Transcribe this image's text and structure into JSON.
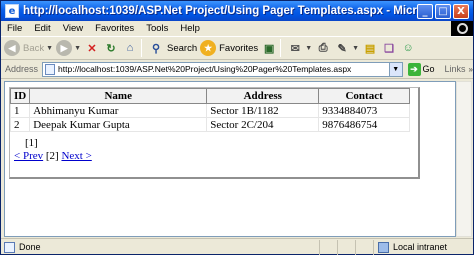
{
  "window": {
    "title": "http://localhost:1039/ASP.Net Project/Using Pager Templates.aspx - Microsoft Internet Explorer",
    "minimize": "_",
    "maximize": "□",
    "close": "X"
  },
  "menu": [
    "File",
    "Edit",
    "View",
    "Favorites",
    "Tools",
    "Help"
  ],
  "toolbar": {
    "back": "Back",
    "search": "Search",
    "favorites": "Favorites"
  },
  "address": {
    "label": "Address",
    "url": "http://localhost:1039/ASP.Net%20Project/Using%20Pager%20Templates.aspx",
    "go": "Go",
    "links": "Links"
  },
  "grid": {
    "headers": [
      "ID",
      "Name",
      "Address",
      "Contact"
    ],
    "rows": [
      [
        "1",
        "Abhimanyu Kumar",
        "Sector 1B/1182",
        "9334884073"
      ],
      [
        "2",
        "Deepak Kumar Gupta",
        "Sector 2C/204",
        "9876486754"
      ]
    ]
  },
  "pager": {
    "current_top": "[1]",
    "prev": "< Prev",
    "current": "[2]",
    "next": "Next >"
  },
  "status": {
    "text": "Done",
    "zone": "Local intranet"
  }
}
